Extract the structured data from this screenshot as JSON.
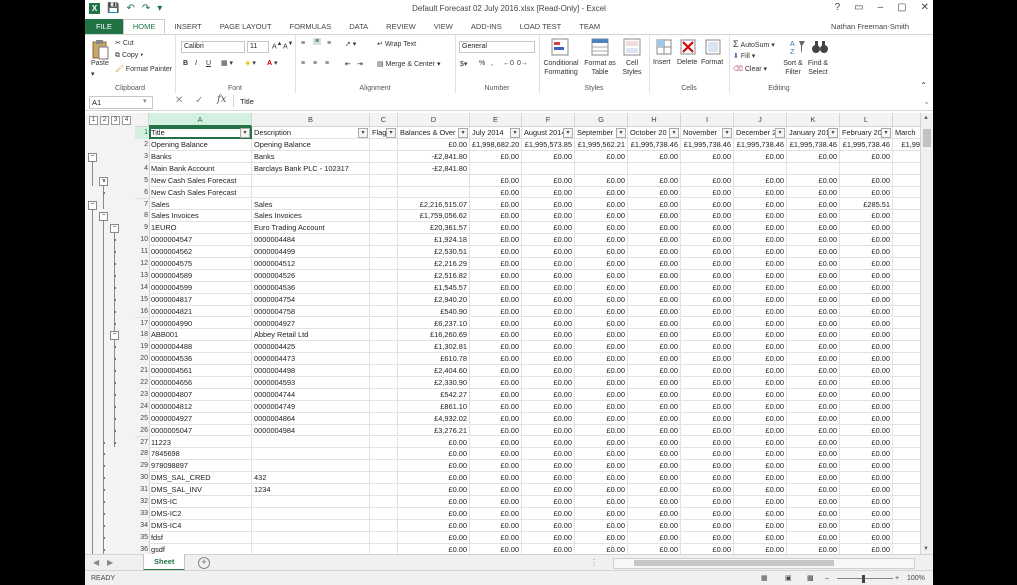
{
  "window": {
    "title": "Default Forecast 02 July 2016.xlsx  [Read-Only] - Excel",
    "controls": [
      "?",
      "▭",
      "–",
      "▢",
      "✕"
    ]
  },
  "tabs": [
    "FILE",
    "HOME",
    "INSERT",
    "PAGE LAYOUT",
    "FORMULAS",
    "DATA",
    "REVIEW",
    "VIEW",
    "ADD-INS",
    "LOAD TEST",
    "TEAM"
  ],
  "active_tab": "HOME",
  "user": "Nathan Freeman-Smith",
  "ribbon": {
    "clipboard": {
      "paste": "Paste",
      "cut": "Cut",
      "copy": "Copy",
      "format_painter": "Format Painter",
      "label": "Clipboard"
    },
    "font": {
      "name": "Calibri",
      "size": "11",
      "label": "Font",
      "bold": "B",
      "italic": "I",
      "underline": "U"
    },
    "alignment": {
      "wrap": "Wrap Text",
      "merge": "Merge & Center",
      "label": "Alignment"
    },
    "number": {
      "format": "General",
      "label": "Number",
      "currency": "$",
      "percent": "%",
      "comma": ","
    },
    "styles": {
      "conditional": "Conditional Formatting",
      "format_table": "Format as Table",
      "cell_styles": "Cell Styles",
      "label": "Styles"
    },
    "cells": {
      "insert": "Insert",
      "delete": "Delete",
      "format": "Format",
      "label": "Cells"
    },
    "editing": {
      "autosum": "AutoSum",
      "fill": "Fill",
      "clear": "Clear",
      "sort": "Sort & Filter",
      "find": "Find & Select",
      "label": "Editing"
    }
  },
  "formula_bar": {
    "name_box": "A1",
    "fx": "fx",
    "content": "Title"
  },
  "outline_levels": [
    "1",
    "2",
    "3",
    "4"
  ],
  "columns": [
    {
      "letter": "A",
      "header": "Title"
    },
    {
      "letter": "B",
      "header": "Description"
    },
    {
      "letter": "C",
      "header": "Flags"
    },
    {
      "letter": "D",
      "header": "Balances & Over"
    },
    {
      "letter": "E",
      "header": "July 2014"
    },
    {
      "letter": "F",
      "header": "August 2014"
    },
    {
      "letter": "G",
      "header": "September"
    },
    {
      "letter": "H",
      "header": "October 20"
    },
    {
      "letter": "I",
      "header": "November"
    },
    {
      "letter": "J",
      "header": "December 2"
    },
    {
      "letter": "K",
      "header": "January 201"
    },
    {
      "letter": "L",
      "header": "February 20"
    },
    {
      "letter": "",
      "header": "March"
    }
  ],
  "rows": [
    {
      "n": "2",
      "cells": [
        "Opening Balance",
        "Opening Balance",
        "",
        "£0.00",
        "£1,998,682.20",
        "£1,995,573.85",
        "£1,995,562.21",
        "£1,995,738.46",
        "£1,995,738.46",
        "£1,995,738.46",
        "£1,995,738.46",
        "£1,995,738.46",
        "£1,99"
      ]
    },
    {
      "n": "3",
      "cells": [
        "Banks",
        "Banks",
        "",
        "-£2,841.80",
        "£0.00",
        "£0.00",
        "£0.00",
        "£0.00",
        "£0.00",
        "£0.00",
        "£0.00",
        "£0.00",
        ""
      ]
    },
    {
      "n": "4",
      "cells": [
        "Main Bank Account",
        "Barclays Bank PLC - 102317",
        "",
        "-£2,841.80",
        "",
        "",
        "",
        "",
        "",
        "",
        "",
        "",
        ""
      ]
    },
    {
      "n": "5",
      "cells": [
        "New Cash Sales Forecast",
        "",
        "",
        "",
        "£0.00",
        "£0.00",
        "£0.00",
        "£0.00",
        "£0.00",
        "£0.00",
        "£0.00",
        "£0.00",
        ""
      ]
    },
    {
      "n": "6",
      "cells": [
        "New Cash Sales Forecast",
        "",
        "",
        "",
        "£0.00",
        "£0.00",
        "£0.00",
        "£0.00",
        "£0.00",
        "£0.00",
        "£0.00",
        "£0.00",
        ""
      ]
    },
    {
      "n": "7",
      "cells": [
        "Sales",
        "Sales",
        "",
        "£2,216,515.07",
        "£0.00",
        "£0.00",
        "£0.00",
        "£0.00",
        "£0.00",
        "£0.00",
        "£0.00",
        "£285.51",
        ""
      ]
    },
    {
      "n": "8",
      "cells": [
        "Sales Invoices",
        "Sales Invoices",
        "",
        "£1,759,056.62",
        "£0.00",
        "£0.00",
        "£0.00",
        "£0.00",
        "£0.00",
        "£0.00",
        "£0.00",
        "£0.00",
        ""
      ]
    },
    {
      "n": "9",
      "cells": [
        "1EURO",
        "Euro Trading Account",
        "",
        "£20,361.57",
        "£0.00",
        "£0.00",
        "£0.00",
        "£0.00",
        "£0.00",
        "£0.00",
        "£0.00",
        "£0.00",
        ""
      ]
    },
    {
      "n": "10",
      "cells": [
        "0000004547",
        "0000004484",
        "",
        "£1,924.18",
        "£0.00",
        "£0.00",
        "£0.00",
        "£0.00",
        "£0.00",
        "£0.00",
        "£0.00",
        "£0.00",
        ""
      ]
    },
    {
      "n": "11",
      "cells": [
        "0000004562",
        "0000004499",
        "",
        "£2,530.51",
        "£0.00",
        "£0.00",
        "£0.00",
        "£0.00",
        "£0.00",
        "£0.00",
        "£0.00",
        "£0.00",
        ""
      ]
    },
    {
      "n": "12",
      "cells": [
        "0000004575",
        "0000004512",
        "",
        "£2,216.29",
        "£0.00",
        "£0.00",
        "£0.00",
        "£0.00",
        "£0.00",
        "£0.00",
        "£0.00",
        "£0.00",
        ""
      ]
    },
    {
      "n": "13",
      "cells": [
        "0000004589",
        "0000004526",
        "",
        "£2,516.82",
        "£0.00",
        "£0.00",
        "£0.00",
        "£0.00",
        "£0.00",
        "£0.00",
        "£0.00",
        "£0.00",
        ""
      ]
    },
    {
      "n": "14",
      "cells": [
        "0000004599",
        "0000004536",
        "",
        "£1,545.57",
        "£0.00",
        "£0.00",
        "£0.00",
        "£0.00",
        "£0.00",
        "£0.00",
        "£0.00",
        "£0.00",
        ""
      ]
    },
    {
      "n": "15",
      "cells": [
        "0000004817",
        "0000004754",
        "",
        "£2,940.20",
        "£0.00",
        "£0.00",
        "£0.00",
        "£0.00",
        "£0.00",
        "£0.00",
        "£0.00",
        "£0.00",
        ""
      ]
    },
    {
      "n": "16",
      "cells": [
        "0000004821",
        "0000004758",
        "",
        "£540.90",
        "£0.00",
        "£0.00",
        "£0.00",
        "£0.00",
        "£0.00",
        "£0.00",
        "£0.00",
        "£0.00",
        ""
      ]
    },
    {
      "n": "17",
      "cells": [
        "0000004990",
        "0000004927",
        "",
        "£6,237.10",
        "£0.00",
        "£0.00",
        "£0.00",
        "£0.00",
        "£0.00",
        "£0.00",
        "£0.00",
        "£0.00",
        ""
      ]
    },
    {
      "n": "18",
      "cells": [
        "ABB001",
        "Abbey Retail Ltd",
        "",
        "£16,260.69",
        "£0.00",
        "£0.00",
        "£0.00",
        "£0.00",
        "£0.00",
        "£0.00",
        "£0.00",
        "£0.00",
        ""
      ]
    },
    {
      "n": "19",
      "cells": [
        "0000004488",
        "0000004425",
        "",
        "£1,302.81",
        "£0.00",
        "£0.00",
        "£0.00",
        "£0.00",
        "£0.00",
        "£0.00",
        "£0.00",
        "£0.00",
        ""
      ]
    },
    {
      "n": "20",
      "cells": [
        "0000004536",
        "0000004473",
        "",
        "£610.78",
        "£0.00",
        "£0.00",
        "£0.00",
        "£0.00",
        "£0.00",
        "£0.00",
        "£0.00",
        "£0.00",
        ""
      ]
    },
    {
      "n": "21",
      "cells": [
        "0000004561",
        "0000004498",
        "",
        "£2,404.60",
        "£0.00",
        "£0.00",
        "£0.00",
        "£0.00",
        "£0.00",
        "£0.00",
        "£0.00",
        "£0.00",
        ""
      ]
    },
    {
      "n": "22",
      "cells": [
        "0000004656",
        "0000004593",
        "",
        "£2,330.90",
        "£0.00",
        "£0.00",
        "£0.00",
        "£0.00",
        "£0.00",
        "£0.00",
        "£0.00",
        "£0.00",
        ""
      ]
    },
    {
      "n": "23",
      "cells": [
        "0000004807",
        "0000004744",
        "",
        "£542.27",
        "£0.00",
        "£0.00",
        "£0.00",
        "£0.00",
        "£0.00",
        "£0.00",
        "£0.00",
        "£0.00",
        ""
      ]
    },
    {
      "n": "24",
      "cells": [
        "0000004812",
        "0000004749",
        "",
        "£861.10",
        "£0.00",
        "£0.00",
        "£0.00",
        "£0.00",
        "£0.00",
        "£0.00",
        "£0.00",
        "£0.00",
        ""
      ]
    },
    {
      "n": "25",
      "cells": [
        "0000004927",
        "0000004864",
        "",
        "£4,932.02",
        "£0.00",
        "£0.00",
        "£0.00",
        "£0.00",
        "£0.00",
        "£0.00",
        "£0.00",
        "£0.00",
        ""
      ]
    },
    {
      "n": "26",
      "cells": [
        "0000005047",
        "0000004984",
        "",
        "£3,276.21",
        "£0.00",
        "£0.00",
        "£0.00",
        "£0.00",
        "£0.00",
        "£0.00",
        "£0.00",
        "£0.00",
        ""
      ]
    },
    {
      "n": "27",
      "cells": [
        "11223",
        "",
        "",
        "£0.00",
        "£0.00",
        "£0.00",
        "£0.00",
        "£0.00",
        "£0.00",
        "£0.00",
        "£0.00",
        "£0.00",
        ""
      ]
    },
    {
      "n": "28",
      "cells": [
        "7845698",
        "",
        "",
        "£0.00",
        "£0.00",
        "£0.00",
        "£0.00",
        "£0.00",
        "£0.00",
        "£0.00",
        "£0.00",
        "£0.00",
        ""
      ]
    },
    {
      "n": "29",
      "cells": [
        "978098897",
        "",
        "",
        "£0.00",
        "£0.00",
        "£0.00",
        "£0.00",
        "£0.00",
        "£0.00",
        "£0.00",
        "£0.00",
        "£0.00",
        ""
      ]
    },
    {
      "n": "30",
      "cells": [
        "DMS_SAL_CRED",
        "432",
        "",
        "£0.00",
        "£0.00",
        "£0.00",
        "£0.00",
        "£0.00",
        "£0.00",
        "£0.00",
        "£0.00",
        "£0.00",
        ""
      ]
    },
    {
      "n": "31",
      "cells": [
        "DMS_SAL_INV",
        "1234",
        "",
        "£0.00",
        "£0.00",
        "£0.00",
        "£0.00",
        "£0.00",
        "£0.00",
        "£0.00",
        "£0.00",
        "£0.00",
        ""
      ]
    },
    {
      "n": "32",
      "cells": [
        "DMS-IC",
        "",
        "",
        "£0.00",
        "£0.00",
        "£0.00",
        "£0.00",
        "£0.00",
        "£0.00",
        "£0.00",
        "£0.00",
        "£0.00",
        ""
      ]
    },
    {
      "n": "33",
      "cells": [
        "DMS-IC2",
        "",
        "",
        "£0.00",
        "£0.00",
        "£0.00",
        "£0.00",
        "£0.00",
        "£0.00",
        "£0.00",
        "£0.00",
        "£0.00",
        ""
      ]
    },
    {
      "n": "34",
      "cells": [
        "DMS-IC4",
        "",
        "",
        "£0.00",
        "£0.00",
        "£0.00",
        "£0.00",
        "£0.00",
        "£0.00",
        "£0.00",
        "£0.00",
        "£0.00",
        ""
      ]
    },
    {
      "n": "35",
      "cells": [
        "fdsf",
        "",
        "",
        "£0.00",
        "£0.00",
        "£0.00",
        "£0.00",
        "£0.00",
        "£0.00",
        "£0.00",
        "£0.00",
        "£0.00",
        ""
      ]
    },
    {
      "n": "36",
      "cells": [
        "gsdf",
        "",
        "",
        "£0.00",
        "£0.00",
        "£0.00",
        "£0.00",
        "£0.00",
        "£0.00",
        "£0.00",
        "£0.00",
        "£0.00",
        ""
      ]
    }
  ],
  "sheet_tab": "Sheet",
  "add_sheet": "+",
  "status": {
    "ready": "READY",
    "zoom": "100%"
  },
  "colors": {
    "accent": "#217346",
    "selection": "#d3f0e0"
  }
}
